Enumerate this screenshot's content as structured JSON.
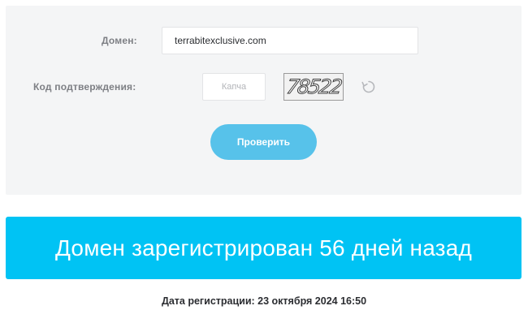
{
  "form": {
    "domain_label": "Домен:",
    "domain_value": "terrabitexclusive.com",
    "code_label": "Код подтверждения:",
    "captcha_placeholder": "Капча",
    "captcha_text": "78522",
    "refresh_icon": "refresh-icon",
    "submit_label": "Проверить"
  },
  "result": {
    "headline": "Домен зарегистрирован 56 дней назад",
    "registration_date": "Дата регистрации: 23 октября 2024 16:50"
  },
  "colors": {
    "button": "#57c2ea",
    "banner": "#00c3f4",
    "panel": "#f4f5f6",
    "label": "#7d7f84"
  }
}
